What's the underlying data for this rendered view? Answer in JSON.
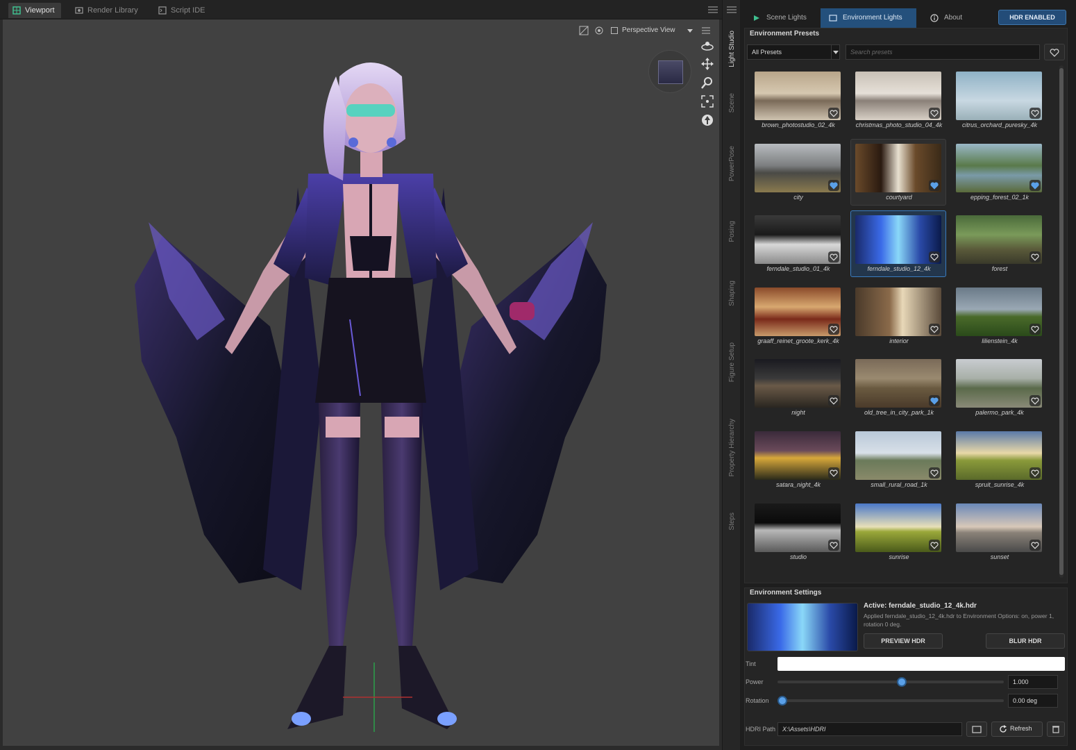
{
  "top_tabs": [
    {
      "label": "Viewport",
      "active": true,
      "icon": "viewport-icon"
    },
    {
      "label": "Render Library",
      "active": false,
      "icon": "render-library-icon"
    },
    {
      "label": "Script IDE",
      "active": false,
      "icon": "script-icon"
    }
  ],
  "viewport": {
    "view_mode": "Perspective View",
    "nav_tools": [
      "orbit-icon",
      "pan-icon",
      "zoom-icon",
      "frame-icon",
      "reset-view-icon"
    ]
  },
  "dock_tabs": [
    {
      "label": "Light Studio",
      "active": true
    },
    {
      "label": "Scene",
      "active": false
    },
    {
      "label": "PowerPose",
      "active": false
    },
    {
      "label": "Posing",
      "active": false
    },
    {
      "label": "Shaping",
      "active": false
    },
    {
      "label": "Figure Setup",
      "active": false
    },
    {
      "label": "Property Hierarchy",
      "active": false
    },
    {
      "label": "Steps",
      "active": false
    }
  ],
  "panel": {
    "tabs": [
      {
        "label": "Scene Lights",
        "active": false,
        "icon": "scene-lights-icon"
      },
      {
        "label": "Environment Lights",
        "active": true,
        "icon": "environment-icon"
      },
      {
        "label": "About",
        "active": false,
        "icon": "info-icon"
      }
    ],
    "hdr_button": "HDR ENABLED",
    "presets_title": "Environment Presets",
    "filter_value": "All Presets",
    "search_placeholder": "Search presets",
    "settings_title": "Environment Settings",
    "active_name": "Active: ferndale_studio_12_4k.hdr",
    "active_desc": "Applied ferndale_studio_12_4k.hdr to Environment Options: on, power 1, rotation 0 deg.",
    "preview_btn": "PREVIEW HDR",
    "blur_btn": "BLUR HDR",
    "tint_label": "Tint",
    "tint_color": "#ffffff",
    "power_label": "Power",
    "power_value": "1.000",
    "power_level": 0.55,
    "rotation_label": "Rotation",
    "rotation_value": "0.00 deg",
    "rotation_level": 0.0,
    "path_label": "HDRI Path",
    "path_value": "X:\\Assets\\HDRI",
    "refresh_btn": "Refresh"
  },
  "presets": [
    {
      "label": "brown_photostudio_02_4k",
      "fav": false,
      "style": "studio-warm"
    },
    {
      "label": "christmas_photo_studio_04_4k",
      "fav": false,
      "style": "studio-light"
    },
    {
      "label": "citrus_orchard_puresky_4k",
      "fav": false,
      "style": "sky"
    },
    {
      "label": "city",
      "fav": true,
      "style": "city"
    },
    {
      "label": "courtyard",
      "fav": true,
      "style": "courtyard",
      "hovered": true
    },
    {
      "label": "epping_forest_02_1k",
      "fav": true,
      "style": "forest-water"
    },
    {
      "label": "ferndale_studio_01_4k",
      "fav": false,
      "style": "studio-dark"
    },
    {
      "label": "ferndale_studio_12_4k",
      "fav": false,
      "style": "studio-blue",
      "selected": true
    },
    {
      "label": "forest",
      "fav": false,
      "style": "forest"
    },
    {
      "label": "graaff_reinet_groote_kerk_4k",
      "fav": false,
      "style": "church"
    },
    {
      "label": "interior",
      "fav": false,
      "style": "interior"
    },
    {
      "label": "lilienstein_4k",
      "fav": false,
      "style": "field-overcast"
    },
    {
      "label": "night",
      "fav": false,
      "style": "night"
    },
    {
      "label": "old_tree_in_city_park_1k",
      "fav": true,
      "style": "park"
    },
    {
      "label": "palermo_park_4k",
      "fav": false,
      "style": "park-light"
    },
    {
      "label": "satara_night_4k",
      "fav": false,
      "style": "satara"
    },
    {
      "label": "small_rural_road_1k",
      "fav": false,
      "style": "rural"
    },
    {
      "label": "spruit_sunrise_4k",
      "fav": false,
      "style": "sunrise-field"
    },
    {
      "label": "studio",
      "fav": false,
      "style": "studio-black"
    },
    {
      "label": "sunrise",
      "fav": false,
      "style": "sunrise"
    },
    {
      "label": "sunset",
      "fav": false,
      "style": "sunset"
    }
  ],
  "colors": {
    "accent": "#3a7cc0",
    "favorite": "#5aa0e8"
  }
}
